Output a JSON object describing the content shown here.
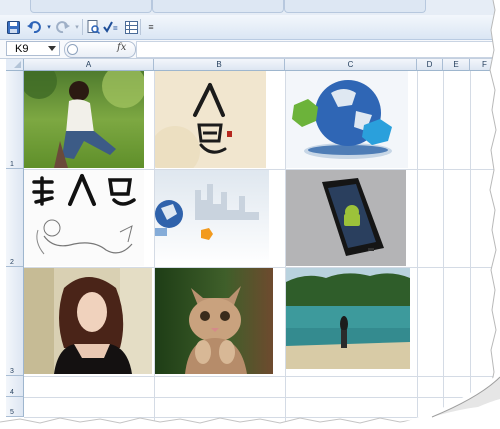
{
  "name_box": {
    "value": "K9"
  },
  "formula_bar": {
    "fx_label": "fx",
    "value": ""
  },
  "columns": [
    "A",
    "B",
    "C",
    "D",
    "E",
    "F"
  ],
  "rows": [
    "1",
    "2",
    "3",
    "4",
    "5"
  ],
  "cells": [
    {
      "cell": "A1",
      "image": "woman-sitting-on-grass-photo"
    },
    {
      "cell": "B1",
      "image": "calligraphy-art-image"
    },
    {
      "cell": "C1",
      "image": "globe-with-cubes-image"
    },
    {
      "cell": "A2",
      "image": "mermaid-calligraphy-image"
    },
    {
      "cell": "B2",
      "image": "globe-city-skyline-image"
    },
    {
      "cell": "C2",
      "image": "android-smartphone-photo"
    },
    {
      "cell": "A3",
      "image": "woman-portrait-photo"
    },
    {
      "cell": "B3",
      "image": "kitten-photo"
    },
    {
      "cell": "C3",
      "image": "lake-landscape-photo"
    }
  ]
}
